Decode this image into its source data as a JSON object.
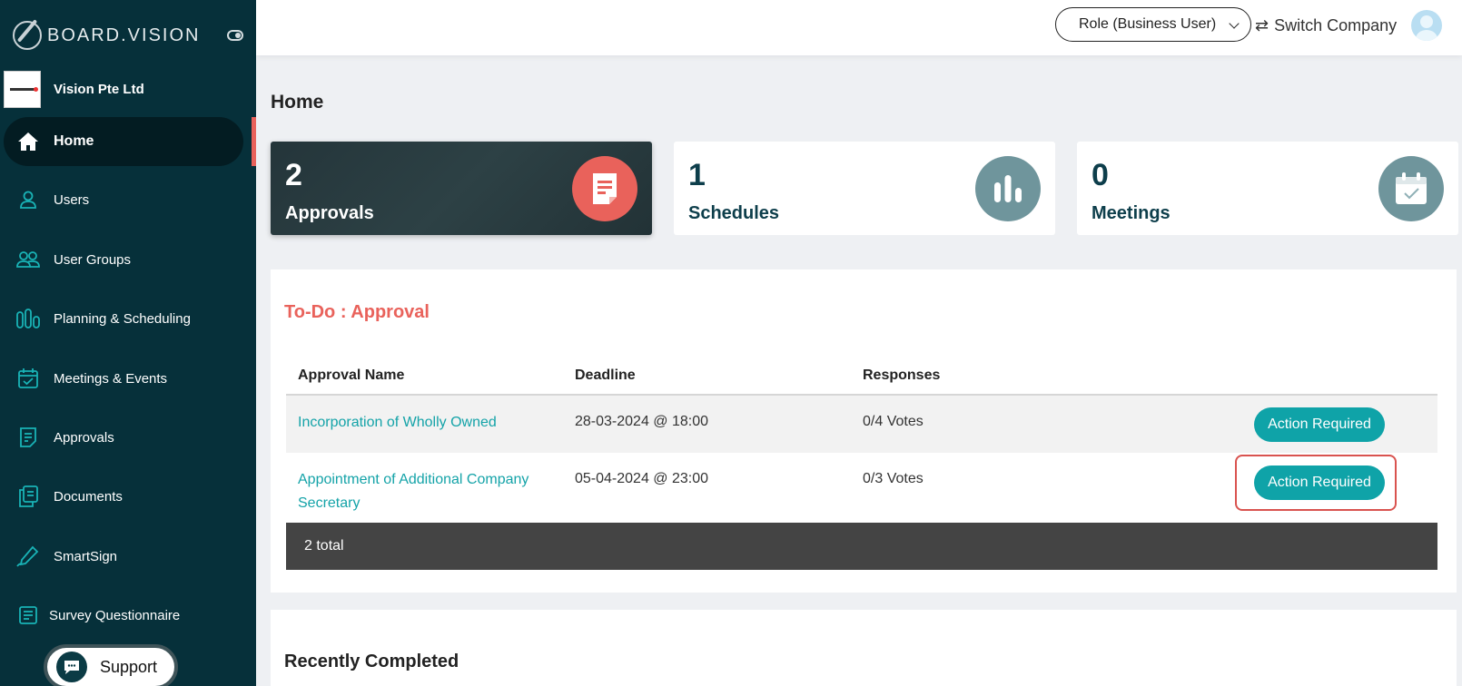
{
  "brand": {
    "logo_text": "BOARD.VISION"
  },
  "company": {
    "name": "Vision Pte Ltd"
  },
  "sidebar": {
    "items": [
      {
        "label": "Home",
        "icon": "home-icon"
      },
      {
        "label": "Users",
        "icon": "user-icon"
      },
      {
        "label": "User Groups",
        "icon": "user-groups-icon"
      },
      {
        "label": "Planning & Scheduling",
        "icon": "bar-chart-icon"
      },
      {
        "label": "Meetings & Events",
        "icon": "calendar-check-icon"
      },
      {
        "label": "Approvals",
        "icon": "document-icon"
      },
      {
        "label": "Documents",
        "icon": "documents-icon"
      },
      {
        "label": "SmartSign",
        "icon": "pen-icon"
      },
      {
        "label": "Survey Questionnaire",
        "icon": "survey-icon"
      }
    ],
    "support_label": "Support"
  },
  "header": {
    "role_label": "Role (Business User)",
    "switch_company_label": "Switch Company"
  },
  "page": {
    "title": "Home"
  },
  "stats": [
    {
      "count": "2",
      "label": "Approvals",
      "icon": "approval-document-icon",
      "color": "#e9625b"
    },
    {
      "count": "1",
      "label": "Schedules",
      "icon": "bar-chart-icon",
      "color": "#6f959c"
    },
    {
      "count": "0",
      "label": "Meetings",
      "icon": "calendar-icon",
      "color": "#6f959c"
    }
  ],
  "todo": {
    "title": "To-Do : Approval",
    "columns": [
      "Approval Name",
      "Deadline",
      "Responses"
    ],
    "rows": [
      {
        "name": "Incorporation of Wholly Owned",
        "deadline": "28-03-2024 @ 18:00",
        "responses": "0/4 Votes",
        "action": "Action Required"
      },
      {
        "name_line1": "Appointment of Additional Company",
        "name_line2": "Secretary",
        "deadline": "05-04-2024 @ 23:00",
        "responses": "0/3 Votes",
        "action": "Action Required"
      }
    ],
    "footer": "2 total"
  },
  "recent": {
    "title": "Recently Completed"
  },
  "colors": {
    "sidebar": "#06303a",
    "accent": "#0fa3a8",
    "alert": "#e9625b"
  }
}
